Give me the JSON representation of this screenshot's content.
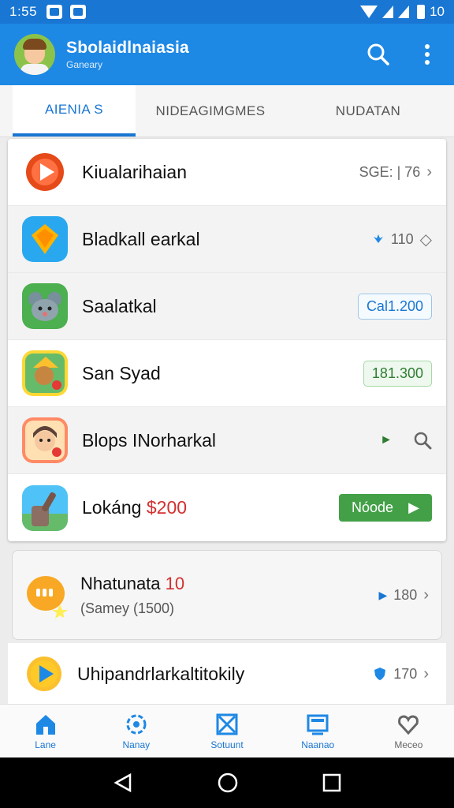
{
  "status_bar": {
    "time": "1:55",
    "battery_text": "10"
  },
  "app_bar": {
    "title": "Sbolaidlnaiasia",
    "subtitle": "Ganeary"
  },
  "tabs": [
    {
      "label": "AIENIA S",
      "active": true
    },
    {
      "label": "NIDEAGIMGMES",
      "active": false
    },
    {
      "label": "NUDATAN",
      "active": false
    }
  ],
  "list": [
    {
      "name": "Kiualarihaian",
      "right_text": "SGE: | 76",
      "icon": "play-icon",
      "accent": "#e53935"
    },
    {
      "name": "Bladkall earkal",
      "right_text": "110",
      "icon": "kite-icon",
      "accent": "#1e88e5"
    },
    {
      "name": "Saalatkal",
      "badge": "Cal1.200",
      "icon": "mouse-icon",
      "accent": "#43a047"
    },
    {
      "name": "San Syad",
      "badge": "181.300",
      "icon": "character-icon",
      "accent": "#fbc02d"
    },
    {
      "name": "Blops INorharkal",
      "icon": "boy-icon",
      "accent": "#ff7043"
    },
    {
      "name": "Lokáng",
      "name_red": "$200",
      "button": "Nóode",
      "icon": "paint-icon",
      "accent": "#29b6f6"
    }
  ],
  "card": {
    "name": "Nhatunata",
    "name_red": "10",
    "sub": "(Samey (1500)",
    "right_text": "180"
  },
  "last_row": {
    "name": "Uhipandrlarkaltitokily",
    "right_text": "170"
  },
  "bottom_nav": [
    {
      "label": "Lane",
      "icon": "home-icon"
    },
    {
      "label": "Nanay",
      "icon": "flower-icon"
    },
    {
      "label": "Sotuunt",
      "icon": "box-x-icon"
    },
    {
      "label": "Naanao",
      "icon": "monitor-icon"
    },
    {
      "label": "Meceo",
      "icon": "heart-icon"
    }
  ],
  "colors": {
    "primary": "#1e88e5",
    "status": "#1976d2",
    "green": "#43a047",
    "red": "#d32f2f"
  }
}
